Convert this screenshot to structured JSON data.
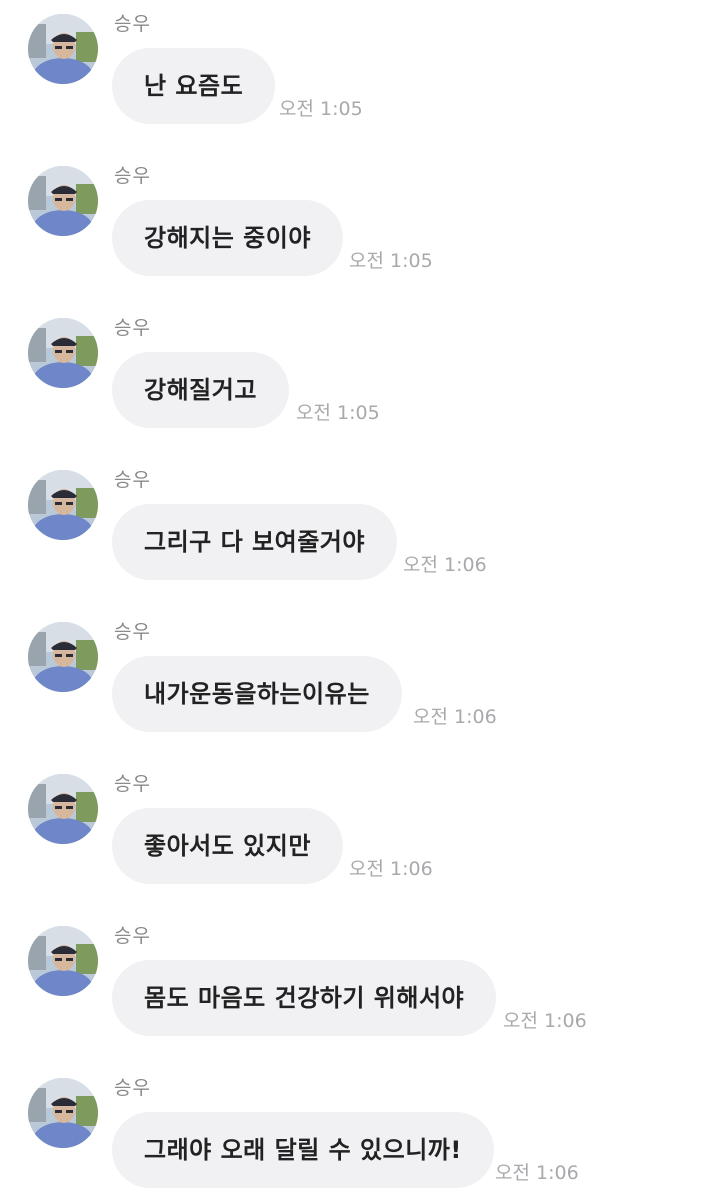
{
  "messages": [
    {
      "sender": "승우",
      "text": "난 요즘도",
      "time": "오전 1:05"
    },
    {
      "sender": "승우",
      "text": "강해지는 중이야",
      "time": "오전 1:05"
    },
    {
      "sender": "승우",
      "text": "강해질거고",
      "time": "오전 1:05"
    },
    {
      "sender": "승우",
      "text": "그리구 다 보여줄거야",
      "time": "오전 1:06"
    },
    {
      "sender": "승우",
      "text": "내가운동을하는이유는",
      "time": "오전 1:06"
    },
    {
      "sender": "승우",
      "text": "좋아서도 있지만",
      "time": "오전 1:06"
    },
    {
      "sender": "승우",
      "text": "몸도 마음도 건강하기 위해서야",
      "time": "오전 1:06"
    },
    {
      "sender": "승우",
      "text": "그래야 오래 달릴 수 있으니까!",
      "time": "오전 1:06"
    }
  ],
  "colors": {
    "bubble": "#f1f1f4",
    "text": "#222222",
    "sender": "#8a8a8e",
    "time": "#a9a9ad"
  },
  "icons": {
    "avatar": "profile-photo"
  }
}
